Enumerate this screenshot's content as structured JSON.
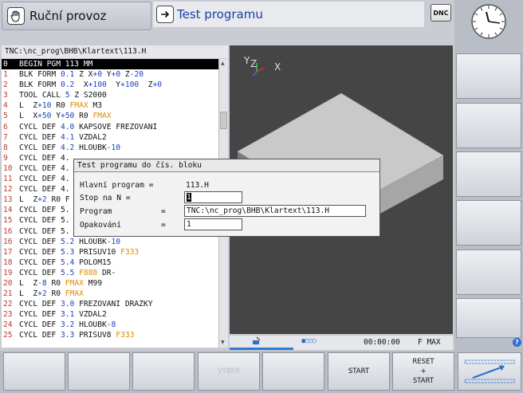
{
  "header": {
    "mode_left": "Ruční provoz",
    "mode_right": "Test programu",
    "dnc": "DNC"
  },
  "program": {
    "path": "TNC:\\nc_prog\\BHB\\Klartext\\113.H",
    "lines": [
      {
        "n": "0",
        "parts": [
          [
            "k",
            "BEGIN PGM 113 MM"
          ]
        ],
        "selected": true
      },
      {
        "n": "1",
        "parts": [
          [
            "k",
            "BLK FORM "
          ],
          [
            "b",
            "0.1"
          ],
          [
            "k",
            " Z X"
          ],
          [
            "b",
            "+0"
          ],
          [
            "k",
            " Y"
          ],
          [
            "b",
            "+0"
          ],
          [
            "k",
            " Z"
          ],
          [
            "b",
            "-20"
          ]
        ]
      },
      {
        "n": "2",
        "parts": [
          [
            "k",
            "BLK FORM "
          ],
          [
            "b",
            "0.2"
          ],
          [
            "k",
            "  X"
          ],
          [
            "b",
            "+100"
          ],
          [
            "k",
            "  Y"
          ],
          [
            "b",
            "+100"
          ],
          [
            "k",
            "  Z"
          ],
          [
            "b",
            "+0"
          ]
        ]
      },
      {
        "n": "3",
        "parts": [
          [
            "k",
            "TOOL CALL "
          ],
          [
            "b",
            "5"
          ],
          [
            "k",
            " Z S2000"
          ]
        ]
      },
      {
        "n": "4",
        "parts": [
          [
            "k",
            "L  Z"
          ],
          [
            "b",
            "+10"
          ],
          [
            "k",
            " R0 "
          ],
          [
            "o",
            "FMAX"
          ],
          [
            "k",
            " M3"
          ]
        ]
      },
      {
        "n": "5",
        "parts": [
          [
            "k",
            "L  X"
          ],
          [
            "b",
            "+50"
          ],
          [
            "k",
            " Y"
          ],
          [
            "b",
            "+50"
          ],
          [
            "k",
            " R0 "
          ],
          [
            "o",
            "FMAX"
          ]
        ]
      },
      {
        "n": "6",
        "parts": [
          [
            "k",
            "CYCL DEF "
          ],
          [
            "b",
            "4.0"
          ],
          [
            "k",
            " KAPSOVE FREZOVANI"
          ]
        ]
      },
      {
        "n": "7",
        "parts": [
          [
            "k",
            "CYCL DEF "
          ],
          [
            "b",
            "4.1"
          ],
          [
            "k",
            " VZDAL2"
          ]
        ]
      },
      {
        "n": "8",
        "parts": [
          [
            "k",
            "CYCL DEF "
          ],
          [
            "b",
            "4.2"
          ],
          [
            "k",
            " HLOUBK"
          ],
          [
            "b",
            "-10"
          ]
        ]
      },
      {
        "n": "9",
        "parts": [
          [
            "k",
            "CYCL DEF 4."
          ]
        ]
      },
      {
        "n": "10",
        "parts": [
          [
            "k",
            "CYCL DEF 4."
          ]
        ]
      },
      {
        "n": "11",
        "parts": [
          [
            "k",
            "CYCL DEF 4."
          ]
        ]
      },
      {
        "n": "12",
        "parts": [
          [
            "k",
            "CYCL DEF 4."
          ]
        ]
      },
      {
        "n": "13",
        "parts": [
          [
            "k",
            "L  Z"
          ],
          [
            "b",
            "+2"
          ],
          [
            "k",
            " R0 F"
          ]
        ]
      },
      {
        "n": "14",
        "parts": [
          [
            "k",
            "CYCL DEF 5."
          ]
        ]
      },
      {
        "n": "15",
        "parts": [
          [
            "k",
            "CYCL DEF 5."
          ]
        ]
      },
      {
        "n": "16",
        "parts": [
          [
            "k",
            "CYCL DEF 5."
          ]
        ]
      },
      {
        "n": "16",
        "parts": [
          [
            "k",
            "CYCL DEF "
          ],
          [
            "b",
            "5.2"
          ],
          [
            "k",
            " HLOUBK"
          ],
          [
            "b",
            "-10"
          ]
        ]
      },
      {
        "n": "17",
        "parts": [
          [
            "k",
            "CYCL DEF "
          ],
          [
            "b",
            "5.3"
          ],
          [
            "k",
            " PRISUV10 "
          ],
          [
            "o",
            "F333"
          ]
        ]
      },
      {
        "n": "18",
        "parts": [
          [
            "k",
            "CYCL DEF "
          ],
          [
            "b",
            "5.4"
          ],
          [
            "k",
            " POLOM15"
          ]
        ]
      },
      {
        "n": "19",
        "parts": [
          [
            "k",
            "CYCL DEF "
          ],
          [
            "b",
            "5.5"
          ],
          [
            "k",
            " "
          ],
          [
            "o",
            "F888"
          ],
          [
            "k",
            " DR-"
          ]
        ]
      },
      {
        "n": "20",
        "parts": [
          [
            "k",
            "L  Z"
          ],
          [
            "b",
            "-8"
          ],
          [
            "k",
            " R0 "
          ],
          [
            "o",
            "FMAX"
          ],
          [
            "k",
            " M99"
          ]
        ]
      },
      {
        "n": "21",
        "parts": [
          [
            "k",
            "L  Z"
          ],
          [
            "b",
            "+2"
          ],
          [
            "k",
            " R0 "
          ],
          [
            "o",
            "FMAX"
          ]
        ]
      },
      {
        "n": "22",
        "parts": [
          [
            "k",
            "CYCL DEF "
          ],
          [
            "b",
            "3.0"
          ],
          [
            "k",
            " FREZOVANI DRAZKY"
          ]
        ]
      },
      {
        "n": "23",
        "parts": [
          [
            "k",
            "CYCL DEF "
          ],
          [
            "b",
            "3.1"
          ],
          [
            "k",
            " VZDAL2"
          ]
        ]
      },
      {
        "n": "24",
        "parts": [
          [
            "k",
            "CYCL DEF "
          ],
          [
            "b",
            "3.2"
          ],
          [
            "k",
            " HLOUBK"
          ],
          [
            "b",
            "-8"
          ]
        ]
      },
      {
        "n": "25",
        "parts": [
          [
            "k",
            "CYCL DEF "
          ],
          [
            "b",
            "3.3"
          ],
          [
            "k",
            " PRISUV8 "
          ],
          [
            "o",
            "F333"
          ]
        ]
      }
    ]
  },
  "dialog": {
    "title": "Test programu do čís. bloku",
    "main_label": "Hlavní program =",
    "main_value": "113.H",
    "stop_label": "Stop na N =",
    "stop_value": "1",
    "program_label": "Program",
    "program_eq": "=",
    "program_value": "TNC:\\nc_prog\\BHB\\Klartext\\113.H",
    "repeat_label": "Opakování",
    "repeat_eq": "=",
    "repeat_value": "1"
  },
  "graphics": {
    "axis_y": "Y",
    "axis_z": "Z",
    "axis_x": "X"
  },
  "status": {
    "time": "00:00:00",
    "feed": "F MAX",
    "dots": "●○○○"
  },
  "softkeys": [
    {
      "label": "",
      "enabled": true
    },
    {
      "label": "",
      "enabled": true
    },
    {
      "label": "",
      "enabled": true
    },
    {
      "label": "VYBER",
      "enabled": false
    },
    {
      "label": "",
      "enabled": true
    },
    {
      "label": "START",
      "enabled": true
    },
    {
      "label": "RESET\n+\nSTART",
      "enabled": true
    },
    {
      "label": "",
      "enabled": true
    }
  ],
  "help": "?",
  "colors": {
    "accent_blue": "#1a3fa6",
    "feed_orange": "#e08a00",
    "number_red": "#c0392b"
  }
}
